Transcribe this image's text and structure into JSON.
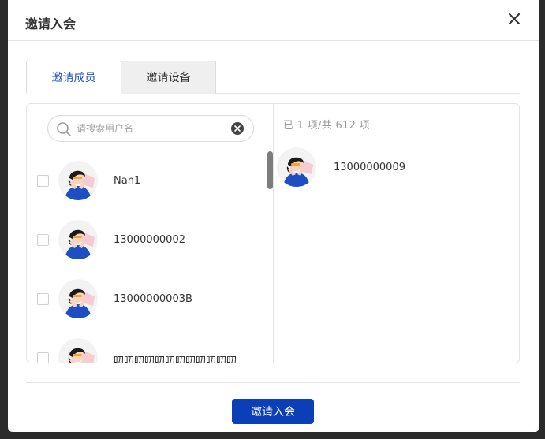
{
  "dialog": {
    "title": "邀请入会",
    "close_icon": "close-icon"
  },
  "tabs": [
    {
      "label": "邀请成员",
      "active": true
    },
    {
      "label": "邀请设备",
      "active": false
    }
  ],
  "search": {
    "placeholder": "请搜索用户名",
    "value": ""
  },
  "members": [
    {
      "name": "Nan1",
      "checked": false
    },
    {
      "name": "13000000002",
      "checked": false
    },
    {
      "name": "13000000003B",
      "checked": false
    },
    {
      "name": "叨叨叨叨叨叨叨叨叨叨叨叨...",
      "checked": false
    }
  ],
  "selected": {
    "summary": "已 1 项/共 612 项",
    "items": [
      {
        "name": "13000000009"
      }
    ]
  },
  "footer": {
    "submit_label": "邀请入会"
  },
  "colors": {
    "accent": "#1a4fc9",
    "button": "#0b3fb8",
    "avatar_blue": "#1e4fc2",
    "avatar_pink": "#f4c7cf"
  }
}
